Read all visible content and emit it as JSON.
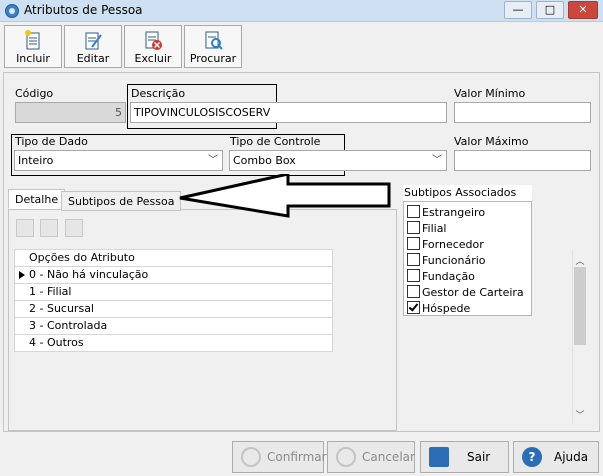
{
  "window": {
    "title": "Atributos de Pessoa",
    "minimize": "—",
    "maximize": "□",
    "close": "✕"
  },
  "toolbar": {
    "incluir": "Incluir",
    "editar": "Editar",
    "excluir": "Excluir",
    "procurar": "Procurar"
  },
  "form": {
    "codigo_label": "Código",
    "codigo_value": "5",
    "descricao_label": "Descrição",
    "descricao_value": "TIPOVINCULOSISCOSERV",
    "valor_minimo_label": "Valor Mínimo",
    "valor_minimo_value": "",
    "tipo_dado_label": "Tipo de Dado",
    "tipo_dado_value": "Inteiro",
    "tipo_controle_label": "Tipo de Controle",
    "tipo_controle_value": "Combo Box",
    "valor_maximo_label": "Valor Máximo",
    "valor_maximo_value": ""
  },
  "tabs": [
    {
      "label": "Detalhe"
    },
    {
      "label": "Subtipos de Pessoa"
    }
  ],
  "options_table": {
    "header": "Opções do Atributo",
    "rows": [
      "0 - Não há vinculação",
      "1 - Filial",
      "2 - Sucursal",
      "3 - Controlada",
      "4 - Outros"
    ]
  },
  "subtypes": {
    "title": "Subtipos Associados",
    "items": [
      {
        "label": "Estrangeiro",
        "checked": false
      },
      {
        "label": "Filial",
        "checked": false
      },
      {
        "label": "Fornecedor",
        "checked": false
      },
      {
        "label": "Funcionário",
        "checked": false
      },
      {
        "label": "Fundação",
        "checked": false
      },
      {
        "label": "Gestor de Carteira",
        "checked": false
      },
      {
        "label": "Hóspede",
        "checked": true
      }
    ]
  },
  "buttons": {
    "confirmar": "Confirmar",
    "cancelar": "Cancelar",
    "sair": "Sair",
    "ajuda": "Ajuda"
  },
  "icons": {
    "app": "app-icon",
    "incluir": "new-document-icon",
    "editar": "edit-document-icon",
    "excluir": "delete-document-icon",
    "procurar": "search-document-icon"
  },
  "colors": {
    "titlebar": "#cfe0f2",
    "close_button": "#c9483b",
    "help_blue": "#2c6eb5",
    "exit_blue": "#2c6eb5"
  }
}
